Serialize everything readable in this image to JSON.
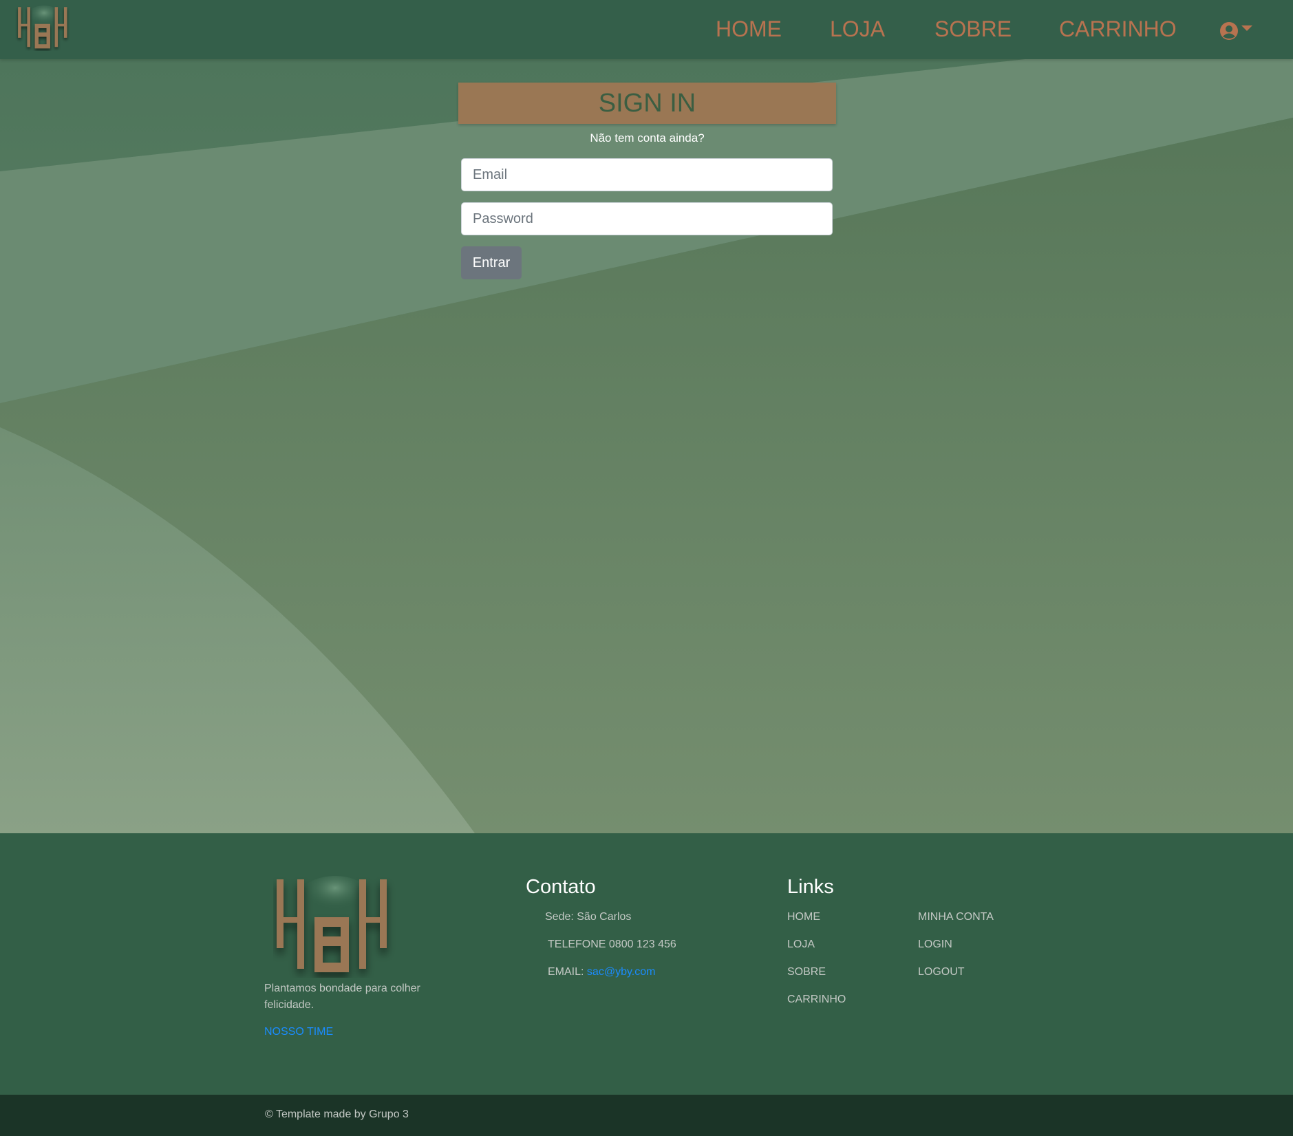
{
  "colors": {
    "nav_bg": "#345f4a",
    "nav_link": "#b87350",
    "accent_brown": "#9a7754",
    "footer_bg": "#335f47",
    "bottom_bar_bg": "#1b3427",
    "link_blue": "#1a8cff"
  },
  "navbar": {
    "logo_icon": "yby-logo",
    "links": [
      "HOME",
      "LOJA",
      "SOBRE",
      "CARRINHO"
    ],
    "user_icon": "user-circle-icon",
    "dropdown_icon": "caret-down-icon"
  },
  "signin": {
    "title": "SIGN IN",
    "signup_prompt": "Não tem conta ainda?",
    "email_placeholder": "Email",
    "password_placeholder": "Password",
    "submit_label": "Entrar"
  },
  "footer": {
    "tagline": "Plantamos bondade para colher felicidade.",
    "team_link": "NOSSO TIME",
    "contact": {
      "title": "Contato",
      "sede": "Sede: São Carlos",
      "phone": "TELEFONE 0800 123 456",
      "email_label": "EMAIL:",
      "email": "sac@yby.com"
    },
    "links": {
      "title": "Links",
      "col1": [
        "HOME",
        "LOJA",
        "SOBRE",
        "CARRINHO"
      ],
      "col2": [
        "MINHA CONTA",
        "LOGIN",
        "LOGOUT"
      ]
    },
    "copyright": "© Template made by Grupo 3"
  }
}
